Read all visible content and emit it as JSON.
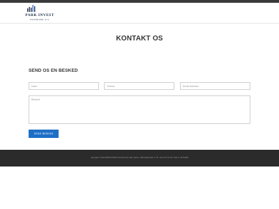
{
  "brand": {
    "name": "PARK INVEST",
    "subtitle": "DANMARK A/S",
    "logo_icon": "building-bars-icon",
    "color": "#1d2c4c"
  },
  "page": {
    "title": "KONTAKT OS"
  },
  "form": {
    "section_title": "SEND OS EN BESKED",
    "name_placeholder": "Navn",
    "phone_placeholder": "Telefon",
    "email_placeholder": "Email Adresse",
    "message_placeholder": "Besked",
    "submit_label": "SEND BESKED",
    "accent_color": "#1e6fc7"
  },
  "footer": {
    "text": "Copyright © 2019 PARK INVEST Danmark A/S, Filip. Nyboe, 1000 København K. Tlf: +45 12 70 21 60, CVR-nr. 36714520"
  }
}
